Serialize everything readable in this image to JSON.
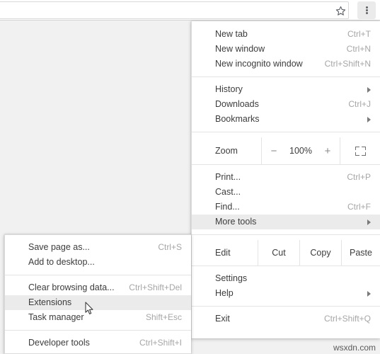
{
  "toolbar": {
    "omnibox_value": "",
    "omnibox_placeholder": "",
    "star_icon": "star-outline-icon",
    "menu_icon": "three-dot-menu-icon"
  },
  "main_menu": {
    "groups": [
      {
        "items": [
          {
            "label": "New tab",
            "accel": "Ctrl+T",
            "arrow": false
          },
          {
            "label": "New window",
            "accel": "Ctrl+N",
            "arrow": false
          },
          {
            "label": "New incognito window",
            "accel": "Ctrl+Shift+N",
            "arrow": false
          }
        ]
      },
      {
        "items": [
          {
            "label": "History",
            "accel": "",
            "arrow": true
          },
          {
            "label": "Downloads",
            "accel": "Ctrl+J",
            "arrow": false
          },
          {
            "label": "Bookmarks",
            "accel": "",
            "arrow": true
          }
        ]
      },
      {
        "items": [
          {
            "label": "Print...",
            "accel": "Ctrl+P",
            "arrow": false
          },
          {
            "label": "Cast...",
            "accel": "",
            "arrow": false
          },
          {
            "label": "Find...",
            "accel": "Ctrl+F",
            "arrow": false
          },
          {
            "label": "More tools",
            "accel": "",
            "arrow": true,
            "highlighted": true
          }
        ]
      },
      {
        "items": [
          {
            "label": "Settings",
            "accel": "",
            "arrow": false
          },
          {
            "label": "Help",
            "accel": "",
            "arrow": true
          }
        ]
      },
      {
        "items": [
          {
            "label": "Exit",
            "accel": "Ctrl+Shift+Q",
            "arrow": false
          }
        ]
      }
    ],
    "zoom_row": {
      "label": "Zoom",
      "minus": "−",
      "value": "100%",
      "plus": "+",
      "fullscreen_icon": "fullscreen-icon"
    },
    "edit_row": {
      "label": "Edit",
      "cut": "Cut",
      "copy": "Copy",
      "paste": "Paste"
    }
  },
  "submenu": {
    "groups": [
      {
        "items": [
          {
            "label": "Save page as...",
            "accel": "Ctrl+S"
          },
          {
            "label": "Add to desktop...",
            "accel": ""
          }
        ]
      },
      {
        "items": [
          {
            "label": "Clear browsing data...",
            "accel": "Ctrl+Shift+Del"
          },
          {
            "label": "Extensions",
            "accel": "",
            "highlighted": true
          },
          {
            "label": "Task manager",
            "accel": "Shift+Esc"
          }
        ]
      },
      {
        "items": [
          {
            "label": "Developer tools",
            "accel": "Ctrl+Shift+I"
          }
        ]
      }
    ]
  },
  "watermark": {
    "text": "wsxdn.com"
  },
  "colors": {
    "menu_background": "#ffffff",
    "page_background": "#f1f1f1",
    "highlight": "#ebebeb",
    "text": "#3c3c3c",
    "accel_text": "#a6a6a6",
    "separator": "#e4e4e4"
  }
}
